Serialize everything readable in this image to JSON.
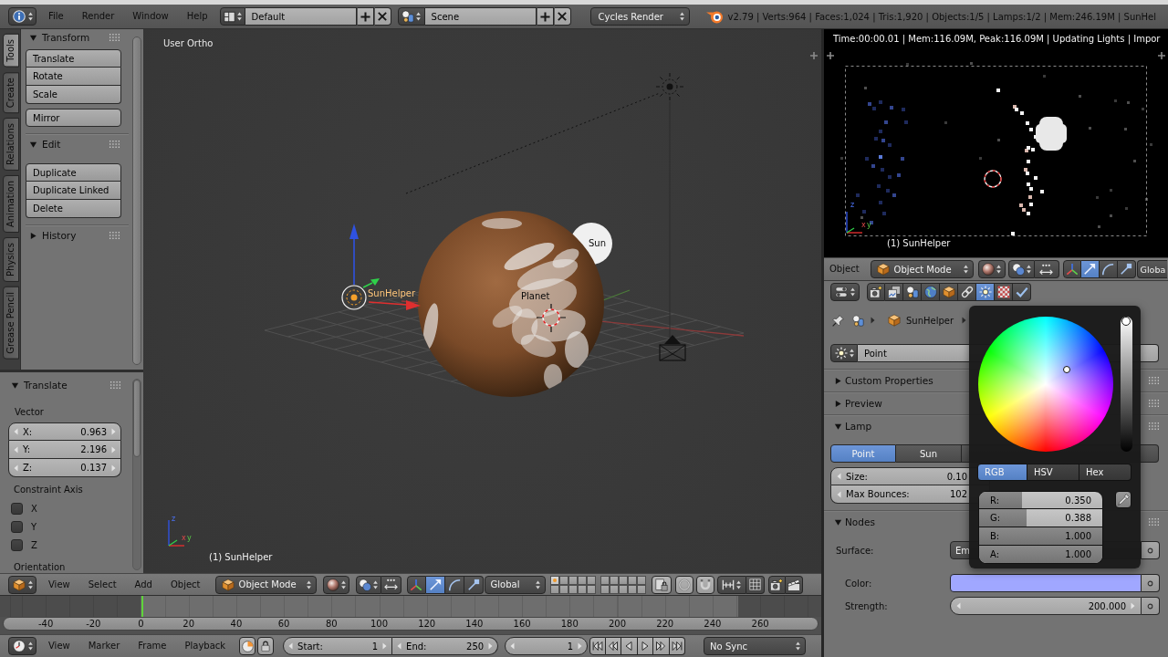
{
  "top_bar": {
    "menus": [
      "File",
      "Render",
      "Window",
      "Help"
    ],
    "layout": "Default",
    "scene": "Scene",
    "engine": "Cycles Render",
    "stats": "v2.79 | Verts:964 | Faces:1,024 | Tris:1,920 | Objects:1/5 | Lamps:1/2 | Mem:246.19M | SunHel"
  },
  "tool_shelf": {
    "tabs": [
      {
        "label": "Tools",
        "selected": true
      },
      {
        "label": "Create",
        "selected": false
      },
      {
        "label": "Relations",
        "selected": false
      },
      {
        "label": "Animation",
        "selected": false
      },
      {
        "label": "Physics",
        "selected": false
      },
      {
        "label": "Grease Pencil",
        "selected": false
      }
    ],
    "panels": [
      {
        "title": "Transform",
        "expanded": true,
        "groups": [
          [
            "Translate",
            "Rotate",
            "Scale"
          ],
          [
            "Mirror"
          ]
        ]
      },
      {
        "title": "Edit",
        "expanded": true,
        "groups": [
          [
            "Duplicate",
            "Duplicate Linked",
            "Delete"
          ]
        ]
      },
      {
        "title": "History",
        "expanded": false
      }
    ]
  },
  "operator_panel": {
    "title": "Translate",
    "expanded": true,
    "vector_label": "Vector",
    "vector": [
      {
        "label": "X:",
        "value": "0.963"
      },
      {
        "label": "Y:",
        "value": "2.196"
      },
      {
        "label": "Z:",
        "value": "0.137"
      }
    ],
    "constraint_label": "Constraint Axis",
    "constraint_axes": [
      {
        "label": "X",
        "checked": false
      },
      {
        "label": "Y",
        "checked": false
      },
      {
        "label": "Z",
        "checked": false
      }
    ],
    "next_label": "Orientation"
  },
  "viewport": {
    "view_name": "User Ortho",
    "objects": [
      {
        "kind": "helper",
        "label": "SunHelper",
        "selected": true
      },
      {
        "kind": "planet",
        "label": "Planet",
        "selected": false
      },
      {
        "kind": "sun",
        "label": "Sun",
        "selected": false
      }
    ],
    "axis_labels": [
      "x",
      "y",
      "z"
    ],
    "active_object": "(1) SunHelper"
  },
  "viewport_header": {
    "menus": [
      "View",
      "Select",
      "Add",
      "Object"
    ],
    "mode": "Object Mode",
    "manipulators": [
      {
        "kind": "axes",
        "selected": false
      },
      {
        "kind": "translate",
        "selected": true
      },
      {
        "kind": "rotate",
        "selected": false
      },
      {
        "kind": "scale",
        "selected": false
      }
    ],
    "orientation": "Global",
    "layers": [
      {
        "selected": true
      },
      {
        "selected": false
      },
      {
        "selected": false
      },
      {
        "selected": false
      },
      {
        "selected": false
      },
      {
        "selected": false
      },
      {
        "selected": false
      },
      {
        "selected": false
      },
      {
        "selected": false
      },
      {
        "selected": false
      },
      {
        "selected": false
      },
      {
        "selected": false
      },
      {
        "selected": false
      },
      {
        "selected": false
      },
      {
        "selected": false
      },
      {
        "selected": false
      },
      {
        "selected": false
      },
      {
        "selected": false
      },
      {
        "selected": false
      },
      {
        "selected": false
      }
    ]
  },
  "timeline": {
    "ticks": [
      "-40",
      "-20",
      "0",
      "20",
      "40",
      "60",
      "80",
      "100",
      "120",
      "140",
      "160",
      "180",
      "200",
      "220",
      "240",
      "260"
    ]
  },
  "timeline_header": {
    "menus": [
      "View",
      "Marker",
      "Frame",
      "Playback"
    ],
    "start_label": "Start:",
    "start": "1",
    "end_label": "End:",
    "end": "250",
    "current_frame": "1",
    "sync": "No Sync"
  },
  "render_preview": {
    "status": "Time:00:00.01 | Mem:116.09M, Peak:116.09M | Updating Lights | Impor",
    "active_object": "(1) SunHelper",
    "axis_labels": [
      "x",
      "y",
      "z"
    ]
  },
  "preview_header": {
    "menu": "Object",
    "mode": "Object Mode",
    "manipulators": [
      {
        "kind": "axes",
        "selected": false
      },
      {
        "kind": "translate",
        "selected": true
      },
      {
        "kind": "rotate",
        "selected": false
      },
      {
        "kind": "scale",
        "selected": false
      }
    ],
    "orientation": "Globa"
  },
  "properties": {
    "context_tabs": [
      {
        "kind": "render",
        "selected": false
      },
      {
        "kind": "render_layers",
        "selected": false
      },
      {
        "kind": "scene",
        "selected": false
      },
      {
        "kind": "world",
        "selected": false
      },
      {
        "kind": "object",
        "selected": false
      },
      {
        "kind": "constraints",
        "selected": false
      },
      {
        "kind": "lamp",
        "selected": true
      },
      {
        "kind": "texture",
        "selected": false
      },
      {
        "kind": "tick",
        "selected": false
      }
    ],
    "breadcrumb": "SunHelper",
    "datablock": "Point",
    "panels": [
      {
        "kind": "plain",
        "title": "Custom Properties",
        "expanded": false
      },
      {
        "kind": "plain",
        "title": "Preview",
        "expanded": false
      },
      {
        "kind": "lamp",
        "title": "Lamp",
        "expanded": true,
        "lamp_types": [
          {
            "label": "Point",
            "selected": true
          },
          {
            "label": "Sun",
            "selected": false
          }
        ],
        "fields": [
          {
            "label": "Size:",
            "value": "0.10"
          },
          {
            "label": "Max Bounces:",
            "value": "102"
          }
        ]
      },
      {
        "kind": "nodes",
        "title": "Nodes",
        "expanded": true,
        "surface_label": "Surface:",
        "surface": "Em",
        "color_label": "Color:",
        "strength_label": "Strength:",
        "strength": "200.000"
      }
    ]
  },
  "color_picker": {
    "value_slider": {
      "level": 1
    },
    "modes": [
      {
        "label": "RGB",
        "selected": true
      },
      {
        "label": "HSV",
        "selected": false
      },
      {
        "label": "Hex",
        "selected": false
      }
    ],
    "channels": [
      {
        "label": "R:",
        "value": "0.350",
        "level": 0.35
      },
      {
        "label": "G:",
        "value": "0.388",
        "level": 0.388
      },
      {
        "label": "B:",
        "value": "1.000",
        "level": 1
      },
      {
        "label": "A:",
        "value": "1.000",
        "level": 1
      }
    ]
  }
}
